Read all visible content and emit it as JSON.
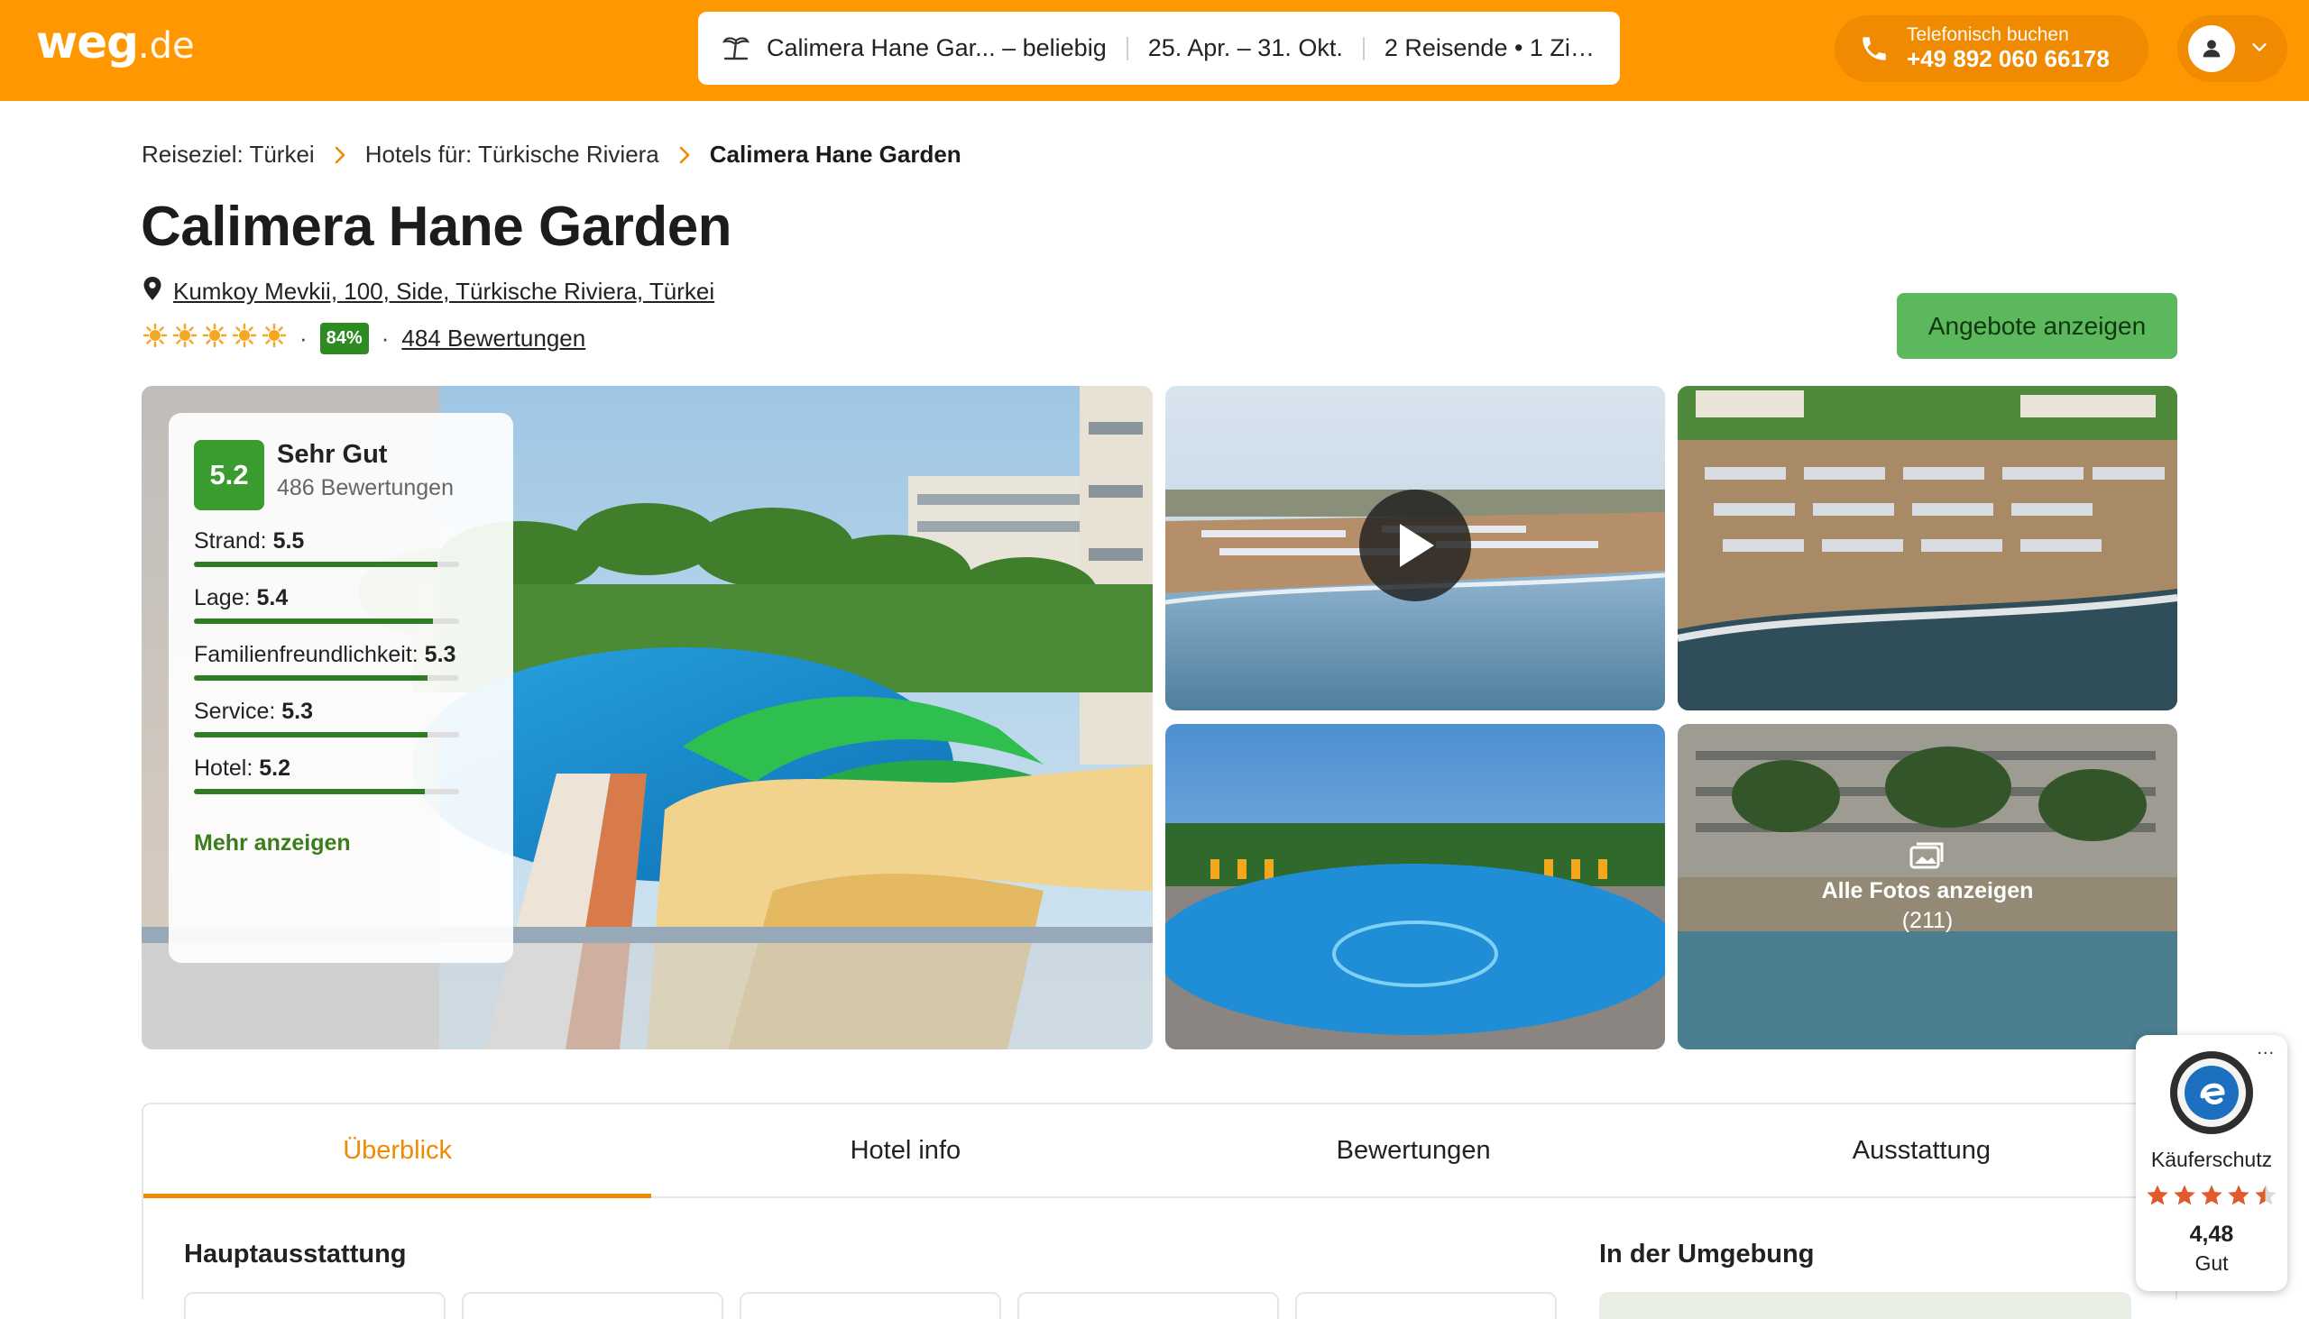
{
  "header": {
    "logo_main": "weg",
    "logo_suffix": ".de",
    "search": {
      "destination": "Calimera Hane Gar...",
      "duration": " – beliebig",
      "dates": "25. Apr. – 31. Okt.",
      "travellers": "2 Reisende • 1 Zim..."
    },
    "phone_label": "Telefonisch buchen",
    "phone_number": "+49 892 060 66178"
  },
  "breadcrumb": {
    "items": [
      "Reiseziel: Türkei",
      "Hotels für: Türkische Riviera"
    ],
    "current": "Calimera Hane Garden"
  },
  "hotel": {
    "name": "Calimera Hane Garden",
    "address": "Kumkoy Mevkii, 100, Side, Türkische Riviera, Türkei",
    "stars": 5,
    "recommendation_pct": "84%",
    "reviews_link": "484 Bewertungen",
    "offers_button": "Angebote anzeigen"
  },
  "rating_card": {
    "score": "5.2",
    "label": "Sehr Gut",
    "count": "486 Bewertungen",
    "criteria": [
      {
        "name": "Strand:",
        "value": "5.5",
        "fraction": 0.92
      },
      {
        "name": "Lage:",
        "value": "5.4",
        "fraction": 0.9
      },
      {
        "name": "Familienfreundlichkeit:",
        "value": "5.3",
        "fraction": 0.88
      },
      {
        "name": "Service:",
        "value": "5.3",
        "fraction": 0.88
      },
      {
        "name": "Hotel:",
        "value": "5.2",
        "fraction": 0.87
      }
    ],
    "more": "Mehr anzeigen"
  },
  "gallery": {
    "all_photos": "Alle Fotos anzeigen",
    "photo_count": "(211)"
  },
  "tabs": [
    "Überblick",
    "Hotel info",
    "Bewertungen",
    "Ausstattung"
  ],
  "sections": {
    "left": "Hauptausstattung",
    "right": "In der Umgebung"
  },
  "trusted_shops": {
    "label": "Käuferschutz",
    "score": "4,48",
    "grade": "Gut",
    "dots": "..."
  },
  "colors": {
    "brand_orange": "#ff9800",
    "green_badge": "#3a9b2e",
    "cta_green": "#5cb85c"
  }
}
